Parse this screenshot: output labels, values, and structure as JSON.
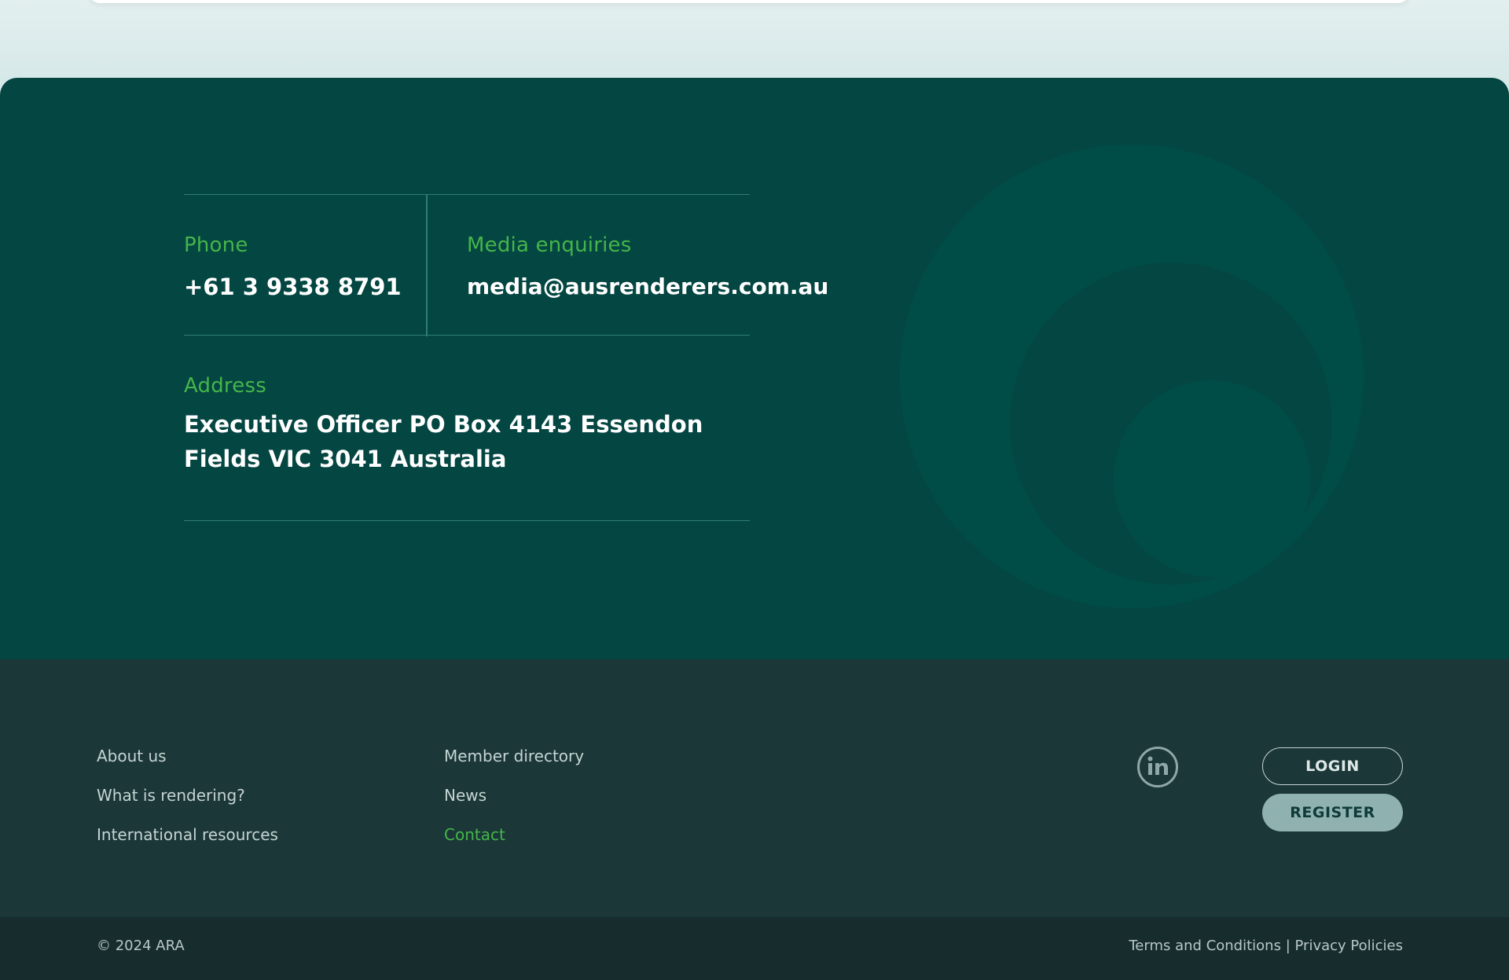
{
  "contact": {
    "phone_label": "Phone",
    "phone_value": "+61 3 9338 8791",
    "media_label": "Media enquiries",
    "media_value": "media@ausrenderers.com.au",
    "address_label": "Address",
    "address_value": "Executive Officer PO Box 4143 Essendon Fields VIC 3041 Australia"
  },
  "footer": {
    "nav_col1": [
      "About us",
      "What is rendering?",
      "International resources"
    ],
    "nav_col2": [
      "Member directory",
      "News",
      "Contact"
    ],
    "active_link": "Contact",
    "social_icon": "linkedin-icon",
    "login_label": "LOGIN",
    "register_label": "REGISTER"
  },
  "bottom": {
    "copyright": "© 2024 ARA",
    "terms": "Terms and Conditions",
    "separator": "|",
    "privacy": "Privacy Policies"
  },
  "colors": {
    "contact_bg": "#044642",
    "accent_green": "#45b54a",
    "footer_bg": "#1b3738",
    "bottom_bg": "#162c2d",
    "register_bg": "#8fb1af"
  }
}
